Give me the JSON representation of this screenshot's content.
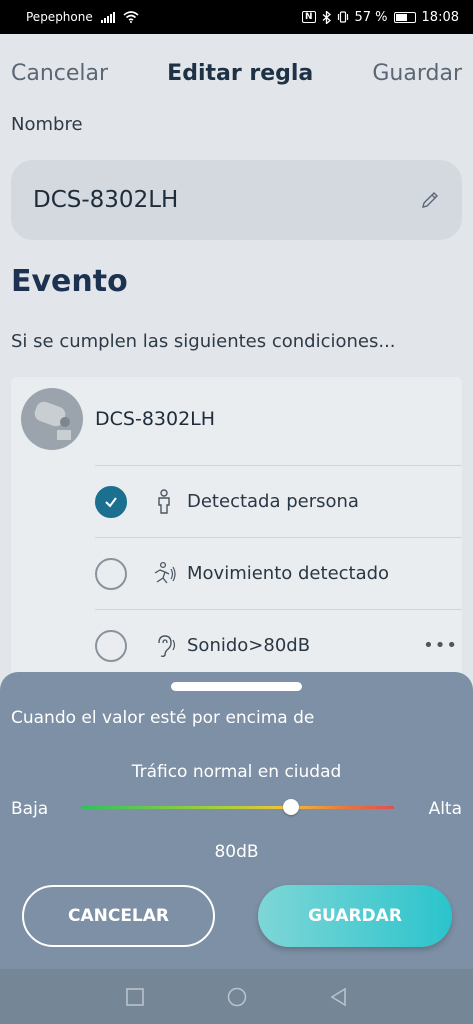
{
  "status_bar": {
    "carrier": "Pepephone",
    "nfc": "N",
    "battery_pct": "57 %",
    "time": "18:08"
  },
  "topbar": {
    "cancel": "Cancelar",
    "title": "Editar regla",
    "save": "Guardar"
  },
  "name": {
    "label": "Nombre",
    "value": "DCS-8302LH"
  },
  "event": {
    "heading": "Evento",
    "conditions_text": "Si se cumplen las siguientes condiciones...",
    "device_name": "DCS-8302LH",
    "options": [
      {
        "label": "Detectada persona",
        "checked": true,
        "icon": "person-icon"
      },
      {
        "label": "Movimiento detectado",
        "checked": false,
        "icon": "motion-icon"
      },
      {
        "label": "Sonido>80dB",
        "checked": false,
        "icon": "ear-icon",
        "more": "•••"
      }
    ]
  },
  "sheet": {
    "threshold_text": "Cuando el valor esté por encima de",
    "level_description": "Tráfico normal en ciudad",
    "low_label": "Baja",
    "high_label": "Alta",
    "slider_fraction": 0.67,
    "value": "80dB",
    "cancel_label": "CANCELAR",
    "save_label": "GUARDAR"
  }
}
